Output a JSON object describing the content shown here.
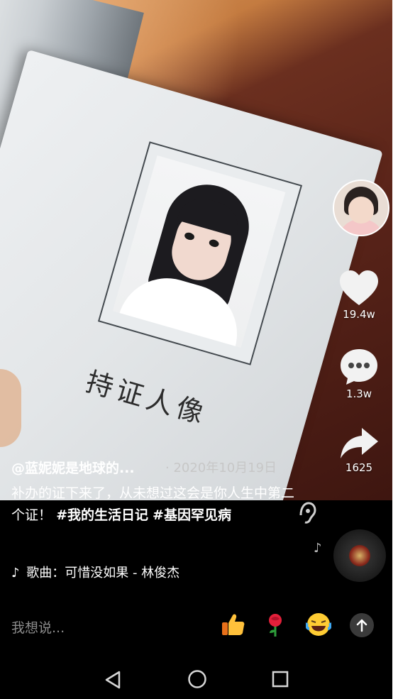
{
  "video": {
    "overlay_text": "持证人像"
  },
  "actions": {
    "like_count": "19.4w",
    "comment_count": "1.3w",
    "share_count": "1625"
  },
  "post": {
    "author": "@蓝妮妮是地球的...",
    "date": "· 2020年10月19日",
    "caption_text": "补办的证下来了，从未想过这会是你人生中第二个证！",
    "hashtags": [
      "#我的生活日记",
      "#基因罕见病"
    ],
    "music_prefix": "♪",
    "music": "歌曲：可惜没如果 - 林俊杰"
  },
  "comment_bar": {
    "placeholder": "我想说..."
  },
  "icons": {
    "like": "heart-icon",
    "comment": "comment-icon",
    "share": "share-icon",
    "headphone": "headphone-icon",
    "note": "music-note-icon",
    "send": "arrow-up-icon"
  },
  "colors": {
    "background": "#000000",
    "text": "#ffffff",
    "muted": "#8c8c8c"
  }
}
